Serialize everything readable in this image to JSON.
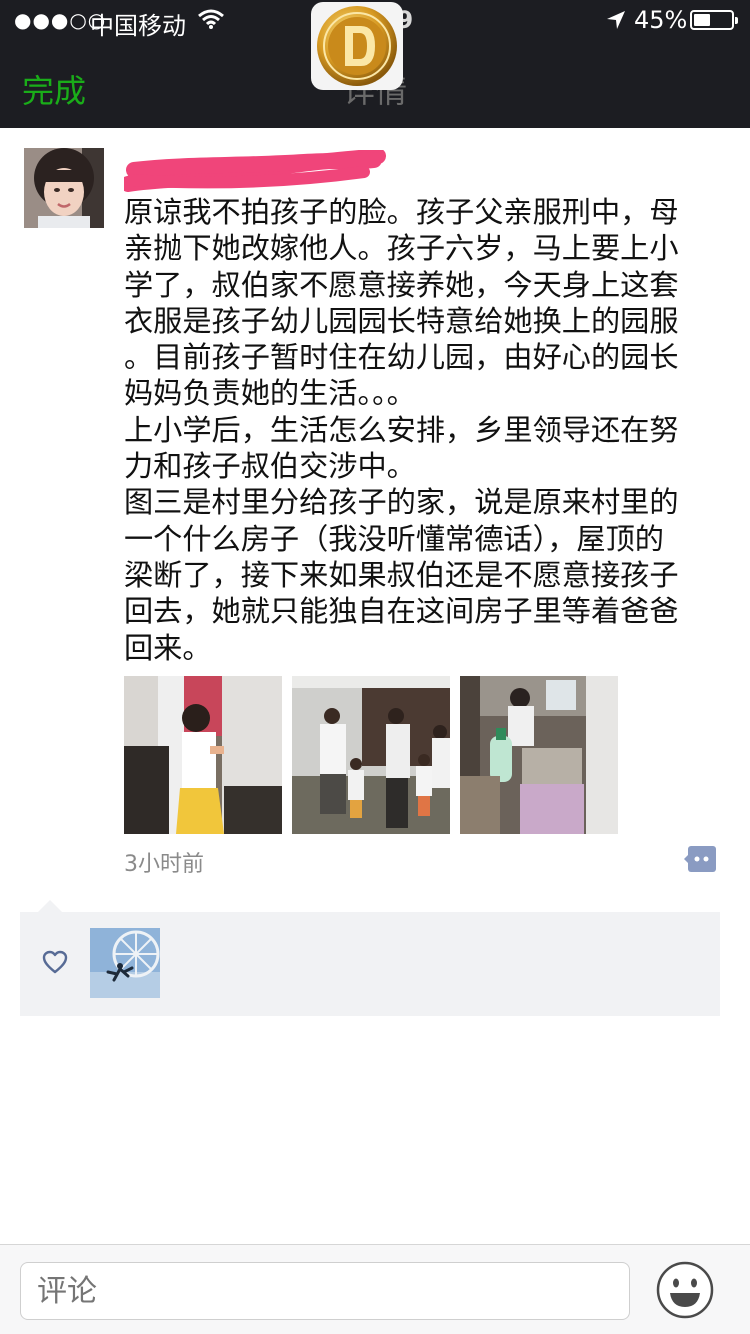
{
  "status_bar": {
    "signal": "●●●○○",
    "carrier": "中国移动",
    "time": "20:29",
    "battery": "45%",
    "battery_level": 0.45
  },
  "nav": {
    "done_label": "完成",
    "title": "详情"
  },
  "post": {
    "author_name": "",
    "text_lines": [
      "原谅我不拍孩子的脸。孩子父亲服刑中，母",
      "亲抛下她改嫁他人。孩子六岁，马上要上小",
      "学了，叔伯家不愿意接养她，今天身上这套",
      "衣服是孩子幼儿园园长特意给她换上的园服",
      "。目前孩子暂时住在幼儿园，由好心的园长",
      "妈妈负责她的生活。。。",
      "上小学后，生活怎么安排，乡里领导还在努",
      "力和孩子叔伯交涉中。",
      "图三是村里分给孩子的家，说是原来村里的",
      "一个什么房子（我没听懂常德话），屋顶的",
      "梁断了，接下来如果叔伯还是不愿意接孩子",
      "回去，她就只能独自在这间房子里等着爸爸",
      "回来。"
    ],
    "time_ago": "3小时前"
  },
  "icons": {
    "wifi": "wifi-icon",
    "location": "location-arrow-icon",
    "comment": "comment-bubble-icon",
    "heart": "heart-icon",
    "emoji": "smiley-icon"
  },
  "comment_bar": {
    "placeholder": "评论"
  },
  "colors": {
    "accent_green": "#1aad19",
    "link_blue": "#576b95",
    "redaction_pink": "#f0457a"
  }
}
